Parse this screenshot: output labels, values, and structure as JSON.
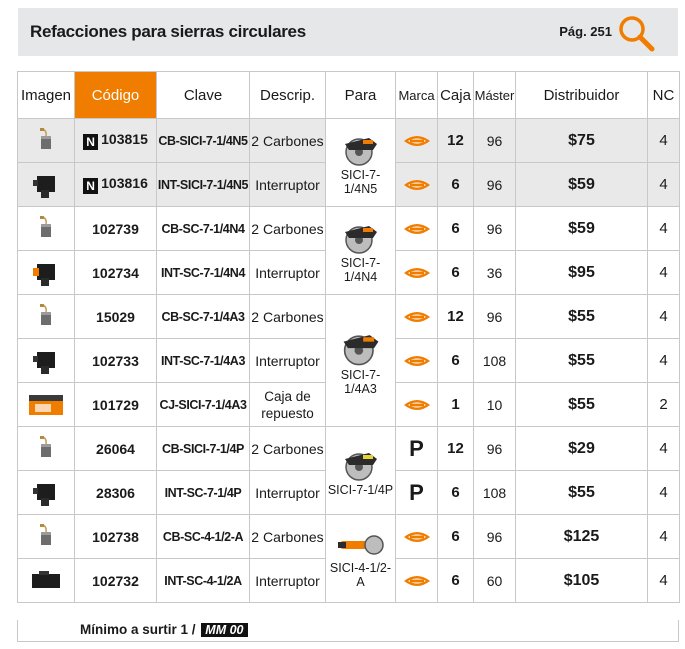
{
  "header": {
    "title": "Refacciones para sierras circulares",
    "page": "Pág. 251"
  },
  "columns": {
    "imagen": "Imagen",
    "codigo": "Código",
    "clave": "Clave",
    "descrip": "Descrip.",
    "para": "Para",
    "marca": "Marca",
    "caja": "Caja",
    "master": "Máster",
    "distribuidor": "Distribuidor",
    "nc": "NC"
  },
  "badge_new": "N",
  "rows": [
    {
      "codigo": "103815",
      "clave": "CB-SICI-7-1/4N5",
      "descrip": "2 Carbones",
      "caja": "12",
      "master": "96",
      "precio": "$75",
      "nc": "4"
    },
    {
      "codigo": "103816",
      "clave": "INT-SICI-7-1/4N5",
      "descrip": "Interruptor",
      "caja": "6",
      "master": "96",
      "precio": "$59",
      "nc": "4"
    },
    {
      "codigo": "102739",
      "clave": "CB-SC-7-1/4N4",
      "descrip": "2 Carbones",
      "caja": "6",
      "master": "96",
      "precio": "$59",
      "nc": "4"
    },
    {
      "codigo": "102734",
      "clave": "INT-SC-7-1/4N4",
      "descrip": "Interruptor",
      "caja": "6",
      "master": "36",
      "precio": "$95",
      "nc": "4"
    },
    {
      "codigo": "15029",
      "clave": "CB-SC-7-1/4A3",
      "descrip": "2 Carbones",
      "caja": "12",
      "master": "96",
      "precio": "$55",
      "nc": "4"
    },
    {
      "codigo": "102733",
      "clave": "INT-SC-7-1/4A3",
      "descrip": "Interruptor",
      "caja": "6",
      "master": "108",
      "precio": "$55",
      "nc": "4"
    },
    {
      "codigo": "101729",
      "clave": "CJ-SICI-7-1/4A3",
      "descrip1": "Caja de",
      "descrip2": "repuesto",
      "caja": "1",
      "master": "10",
      "precio": "$55",
      "nc": "2"
    },
    {
      "codigo": "26064",
      "clave": "CB-SICI-7-1/4P",
      "descrip": "2 Carbones",
      "marca": "P",
      "caja": "12",
      "master": "96",
      "precio": "$29",
      "nc": "4"
    },
    {
      "codigo": "28306",
      "clave": "INT-SC-7-1/4P",
      "descrip": "Interruptor",
      "marca": "P",
      "caja": "6",
      "master": "108",
      "precio": "$55",
      "nc": "4"
    },
    {
      "codigo": "102738",
      "clave": "CB-SC-4-1/2-A",
      "descrip": "2 Carbones",
      "caja": "6",
      "master": "96",
      "precio": "$125",
      "nc": "4"
    },
    {
      "codigo": "102732",
      "clave": "INT-SC-4-1/2A",
      "descrip": "Interruptor",
      "caja": "6",
      "master": "60",
      "precio": "$105",
      "nc": "4"
    }
  ],
  "para": [
    "SICI-7-1/4N5",
    "SICI-7-1/4N4",
    "SICI-7-1/4A3",
    "SICI-7-1/4P",
    "SICI-4-1/2-A"
  ],
  "footer": {
    "text": "Mínimo a surtir 1 /",
    "badge": "MM 00"
  },
  "colors": {
    "accent": "#f07d00",
    "header_bg": "#e6e7e9",
    "shade": "#e9e9ea"
  }
}
